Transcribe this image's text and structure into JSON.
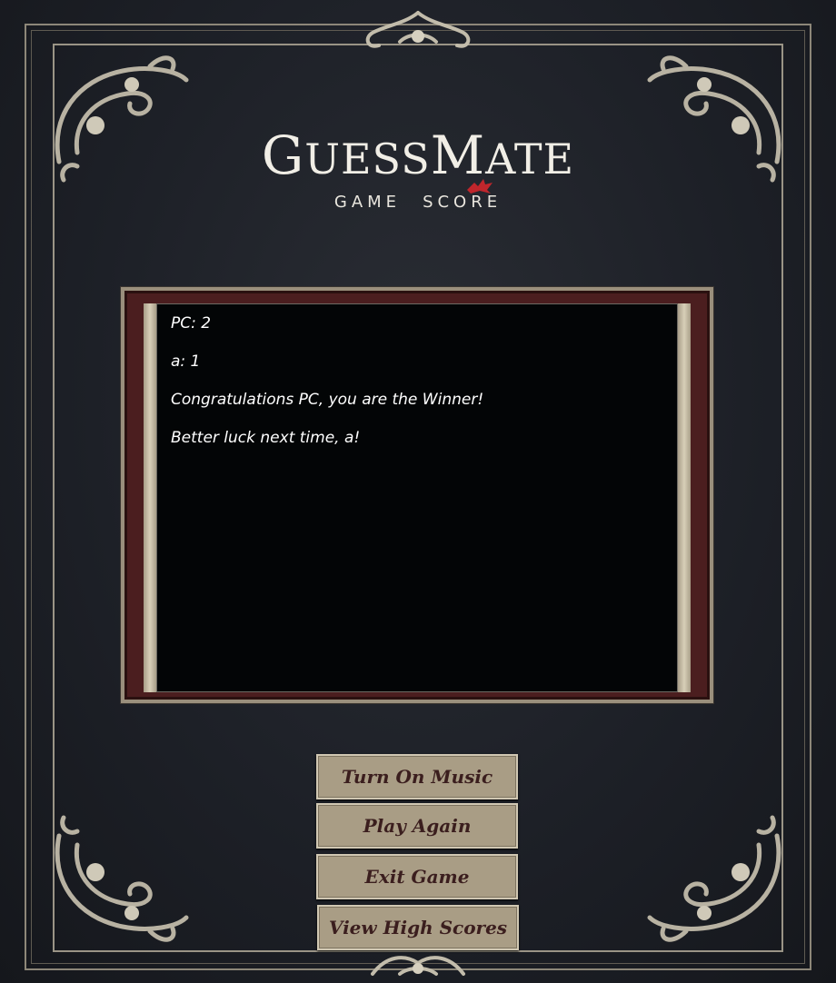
{
  "header": {
    "title_part1": "G",
    "title_part2": "UESS",
    "title_part3": "M",
    "title_part4": "ATE",
    "subtitle_left": "GAME",
    "subtitle_right": "SCORE"
  },
  "scores": {
    "lines": [
      "PC: 2",
      "a: 1",
      "Congratulations PC, you are the Winner!",
      "Better luck next time, a!"
    ]
  },
  "buttons": {
    "music": "Turn On Music",
    "play_again": "Play Again",
    "exit": "Exit Game",
    "high_scores": "View High Scores"
  },
  "colors": {
    "background": "#1d2027",
    "score_box": "#030506",
    "button_bg": "#a99d85",
    "button_text": "#3b1e1e",
    "panel_frame": "#4b1e1f",
    "flag": "#c0262c"
  }
}
